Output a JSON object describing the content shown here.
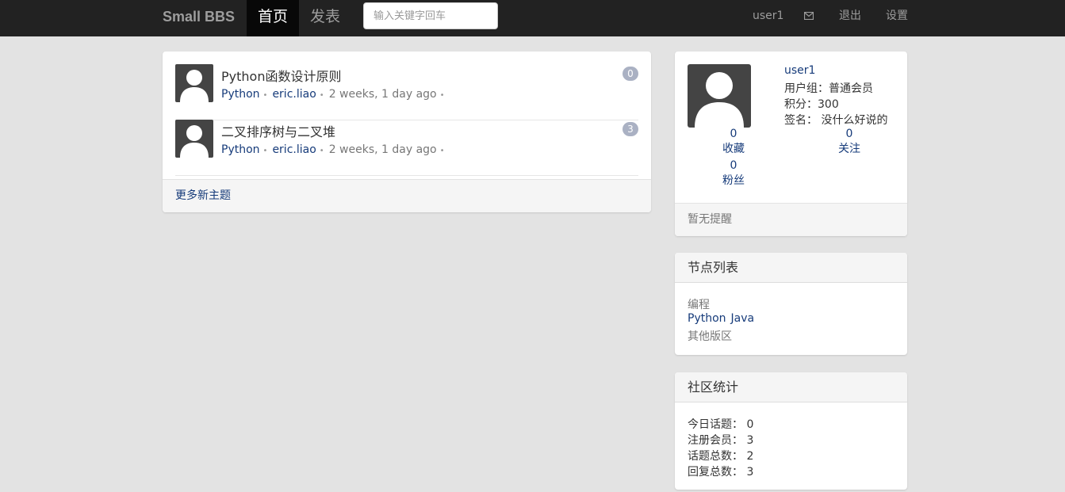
{
  "navbar": {
    "brand": "Small BBS",
    "home": "首页",
    "post": "发表",
    "search_placeholder": "输入关键字回车",
    "user": "user1",
    "mail_icon": "envelope-icon",
    "logout": "退出",
    "settings": "设置"
  },
  "topics": [
    {
      "title": "Python函数设计原则",
      "node": "Python",
      "author": "eric.liao",
      "time": "2 weeks, 1 day ago",
      "replies": "0"
    },
    {
      "title": "二叉排序树与二叉堆",
      "node": "Python",
      "author": "eric.liao",
      "time": "2 weeks, 1 day ago",
      "replies": "3"
    }
  ],
  "topics_footer": "更多新主题",
  "user_panel": {
    "name": "user1",
    "group": "用户组：普通会员",
    "points": "积分：300",
    "signature": "签名： 没什么好说的",
    "favorites_count": "0",
    "favorites_label": "收藏",
    "following_count": "0",
    "following_label": "关注",
    "followers_count": "0",
    "followers_label": "粉丝",
    "footer": "暂无提醒"
  },
  "nodes_panel": {
    "title": "节点列表",
    "category": "编程",
    "nodes": [
      "Python",
      "Java"
    ],
    "other": "其他版区"
  },
  "stats_panel": {
    "title": "社区统计",
    "today": "今日话题： 0",
    "members": "注册会员： 3",
    "topics": "话题总数： 2",
    "replies": "回复总数： 3"
  },
  "colors": {
    "navbar": "#222222",
    "link": "#163b7a",
    "badge": "#aab1c3",
    "page_bg": "#e3e3e3"
  }
}
